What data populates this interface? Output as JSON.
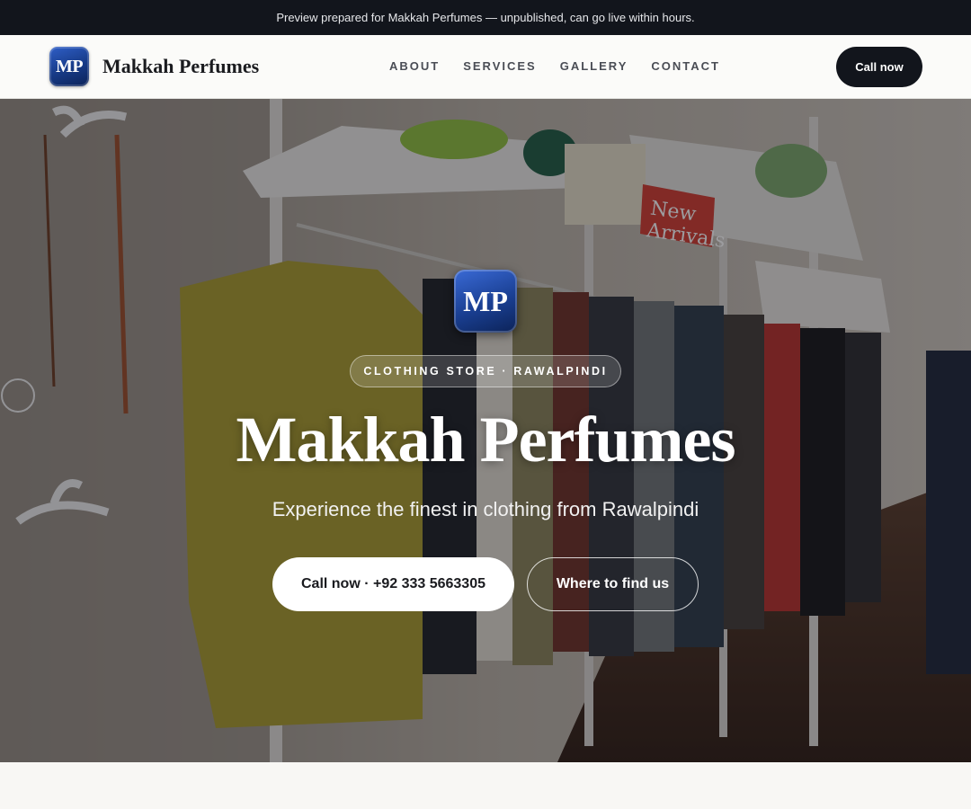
{
  "announcement": {
    "text": "Preview prepared for Makkah Perfumes — unpublished, can go live within hours."
  },
  "header": {
    "logo_initials": "MP",
    "brand_name": "Makkah Perfumes",
    "nav": [
      {
        "label": "ABOUT"
      },
      {
        "label": "SERVICES"
      },
      {
        "label": "GALLERY"
      },
      {
        "label": "CONTACT"
      }
    ],
    "cta_label": "Call now"
  },
  "hero": {
    "background_image": "photo of a clothing store interior with hanging garments and wall shelves",
    "sign_text": [
      "New",
      "Arrivals"
    ],
    "logo_initials": "MP",
    "badge": "CLOTHING STORE · RAWALPINDI",
    "title": "Makkah Perfumes",
    "subtitle": "Experience the finest in clothing from Rawalpindi",
    "primary_button": "Call now · +92 333 5663305",
    "secondary_button": "Where to find us"
  },
  "colors": {
    "dark": "#12151c",
    "logo_blue": "#1a3f92",
    "page_bg": "#f8f7f4"
  }
}
